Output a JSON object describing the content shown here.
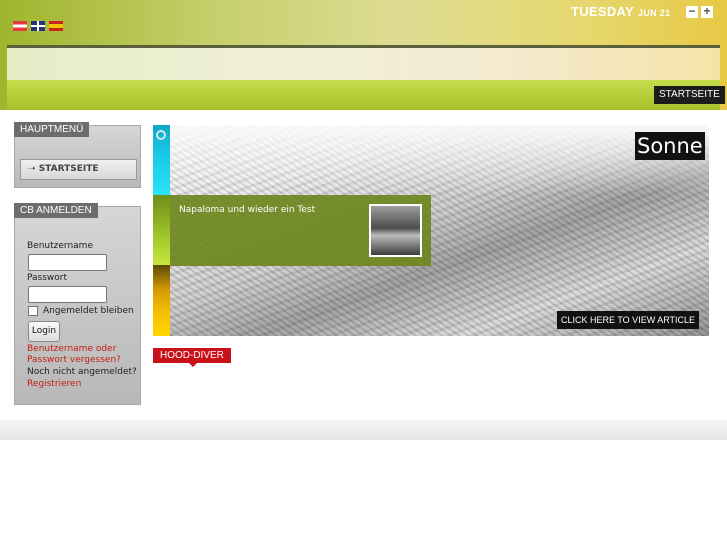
{
  "header": {
    "date_day": "TUESDAY",
    "date_month": "JUN 21",
    "flags": [
      "austria-flag",
      "uk-flag",
      "spain-flag"
    ],
    "resize_minus": "−",
    "resize_plus": "+",
    "nav_home": "STARTSEITE"
  },
  "menu": {
    "title": "HAUPTMENÜ",
    "items": [
      {
        "arrow": "➝",
        "label": "STARTSEITE"
      }
    ]
  },
  "login": {
    "title": "CB ANMELDEN",
    "username_label": "Benutzername",
    "username_value": "",
    "password_label": "Passwort",
    "password_value": "",
    "remember_label": "Angemeldet bleiben",
    "login_button": "Login",
    "forgot_line1": "Benutzername oder",
    "forgot_line2": "Passwort vergessen?",
    "not_registered": "Noch nicht angemeldet?",
    "register": "Registrieren"
  },
  "slider": {
    "headline": "Sonne",
    "article_title": "Napaloma und wieder ein Test",
    "cta": "CLICK HERE TO VIEW ARTICLE"
  },
  "section": {
    "tag": "HOOD-DIVER"
  },
  "colors": {
    "accent_green": "#a9c02a",
    "tag_red": "#c8111b",
    "link_red": "#c41f16"
  }
}
